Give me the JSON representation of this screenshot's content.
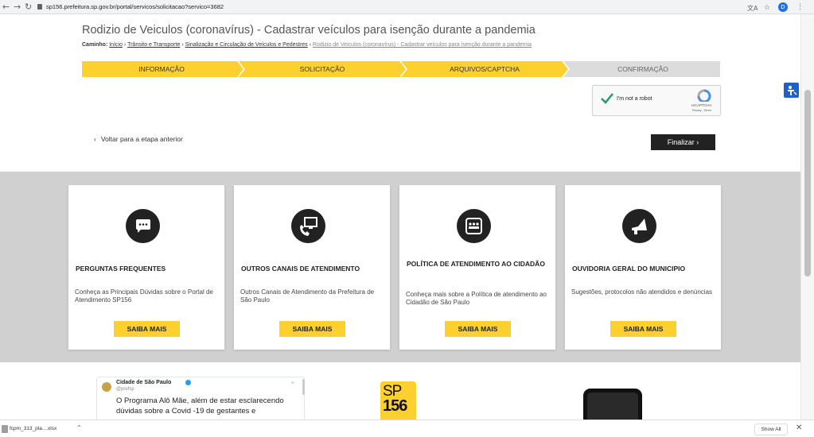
{
  "browser": {
    "url": "sp156.prefeitura.sp.gov.br/portal/servicos/solicitacao?servico=3682",
    "profile_initial": "D"
  },
  "page": {
    "title": "Rodizio de Veiculos (coronavírus) - Cadastrar veículos para isenção durante a pandemia",
    "breadcrumb": {
      "label": "Caminho:",
      "items": [
        "Início",
        "Trânsito e Transporte",
        "Sinalização e Circulação de Veículos e Pedestres",
        "Rodizio de Veiculos (coronavírus) - Cadastrar veículos para isenção durante a pandemia"
      ]
    },
    "steps": [
      {
        "label": "INFORMAÇÃO",
        "active": true
      },
      {
        "label": "SOLICITAÇÃO",
        "active": true
      },
      {
        "label": "ARQUIVOS/CAPTCHA",
        "active": true
      },
      {
        "label": "CONFIRMAÇÃO",
        "active": false
      }
    ],
    "captcha": {
      "label": "I'm not a robot",
      "brand": "reCAPTCHA",
      "links": "Privacy - Terms"
    },
    "back_label": "Voltar para a etapa anterior",
    "finalizar_label": "Finalizar"
  },
  "cards": [
    {
      "title": "PERGUNTAS FREQUENTES",
      "text": "Conheça as Principais Dúvidas sobre o Portal de Atendimento SP156",
      "button": "SAIBA MAIS",
      "icon": "chat-bubble-icon"
    },
    {
      "title": "OUTROS CANAIS DE ATENDIMENTO",
      "text": "Outros Canais de Atendimento da Prefeitura de São Paulo",
      "button": "SAIBA MAIS",
      "icon": "phone-monitor-icon"
    },
    {
      "title": "POLÍTICA DE ATENDIMENTO AO CIDADÃO",
      "text": "Conheça mais sobre a Política de atendimento ao Cidadão de São Paulo",
      "button": "SAIBA MAIS",
      "icon": "people-board-icon"
    },
    {
      "title": "OUVIDORIA GERAL DO MUNICIPIO",
      "text": "Sugestões, protocolos não atendidos e denúncias",
      "button": "SAIBA MAIS",
      "icon": "megaphone-icon"
    }
  ],
  "tweet": {
    "author": "Cidade de São Paulo",
    "handle": "@prefsp",
    "text": "O Programa Alô Mãe, além de estar esclarecendo dúvidas sobre a Covid -19 de gestantes e"
  },
  "logo": {
    "top": "SP",
    "bottom": "156"
  },
  "downloads": {
    "file": "fcpm_313_pla....xlsx",
    "show_all": "Show All"
  }
}
